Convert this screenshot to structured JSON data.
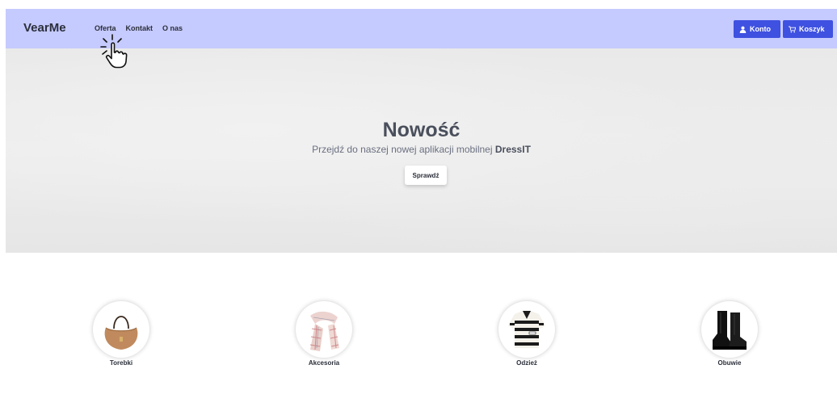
{
  "navbar": {
    "brand": "VearMe",
    "links": [
      "Oferta",
      "Kontakt",
      "O nas"
    ],
    "account_label": "Konto",
    "cart_label": "Koszyk",
    "bg_color": "#c5caff",
    "button_color": "#3f51e0"
  },
  "hero": {
    "title": "Nowość",
    "subtitle_prefix": "Przejdź do naszej nowej aplikacji mobilnej",
    "subtitle_app": "DressIT",
    "button_label": "Sprawdź"
  },
  "categories": [
    {
      "label": "Torebki",
      "icon": "handbag-icon"
    },
    {
      "label": "Akcesoria",
      "icon": "scarf-icon"
    },
    {
      "label": "Odzież",
      "icon": "sweater-icon"
    },
    {
      "label": "Obuwie",
      "icon": "boots-icon"
    }
  ]
}
